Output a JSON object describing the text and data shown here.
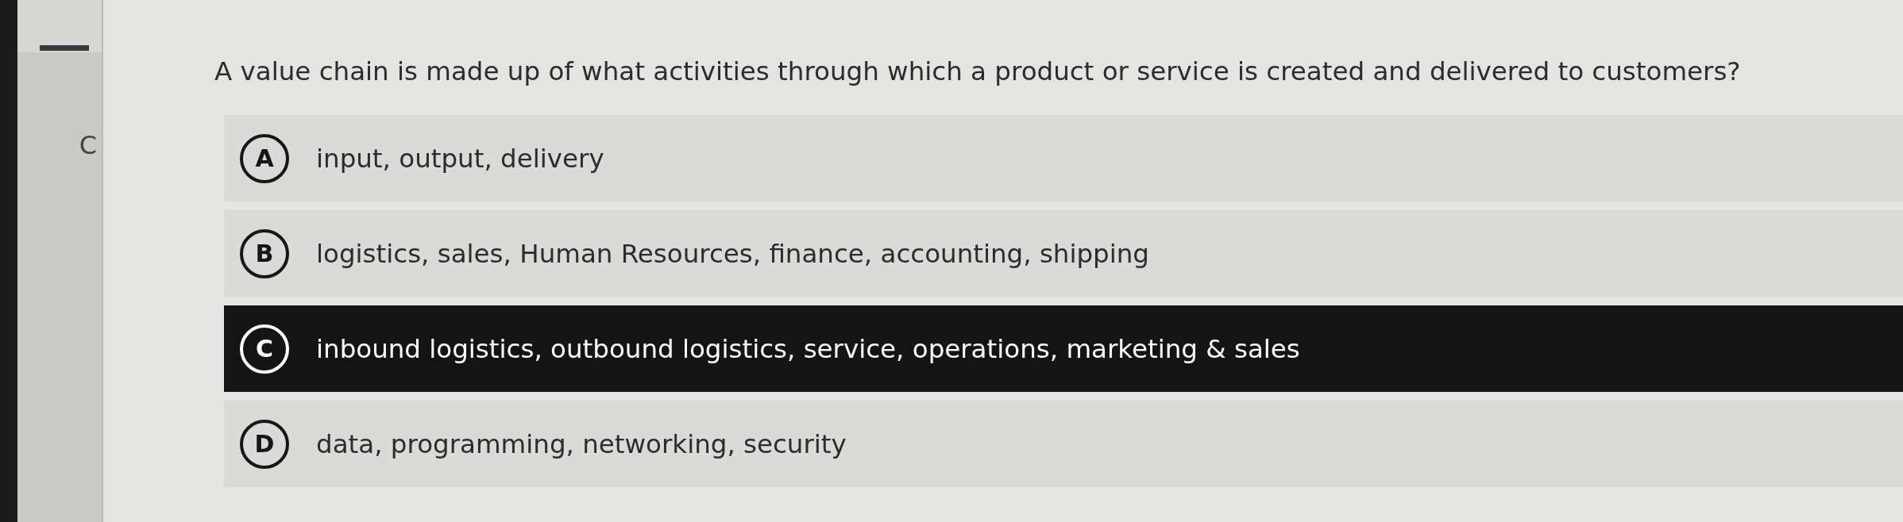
{
  "sidebar": {
    "letter": "C"
  },
  "question": {
    "text": "A value chain is made up of what activities through which a product or service is created and delivered to customers?"
  },
  "options": [
    {
      "letter": "A",
      "text": "input, output, delivery",
      "selected": false
    },
    {
      "letter": "B",
      "text": "logistics, sales, Human Resources, finance, accounting, shipping",
      "selected": false
    },
    {
      "letter": "C",
      "text": "inbound logistics, outbound logistics, service, operations, marketing & sales",
      "selected": true
    },
    {
      "letter": "D",
      "text": "data, programming, networking, security",
      "selected": false
    }
  ]
}
